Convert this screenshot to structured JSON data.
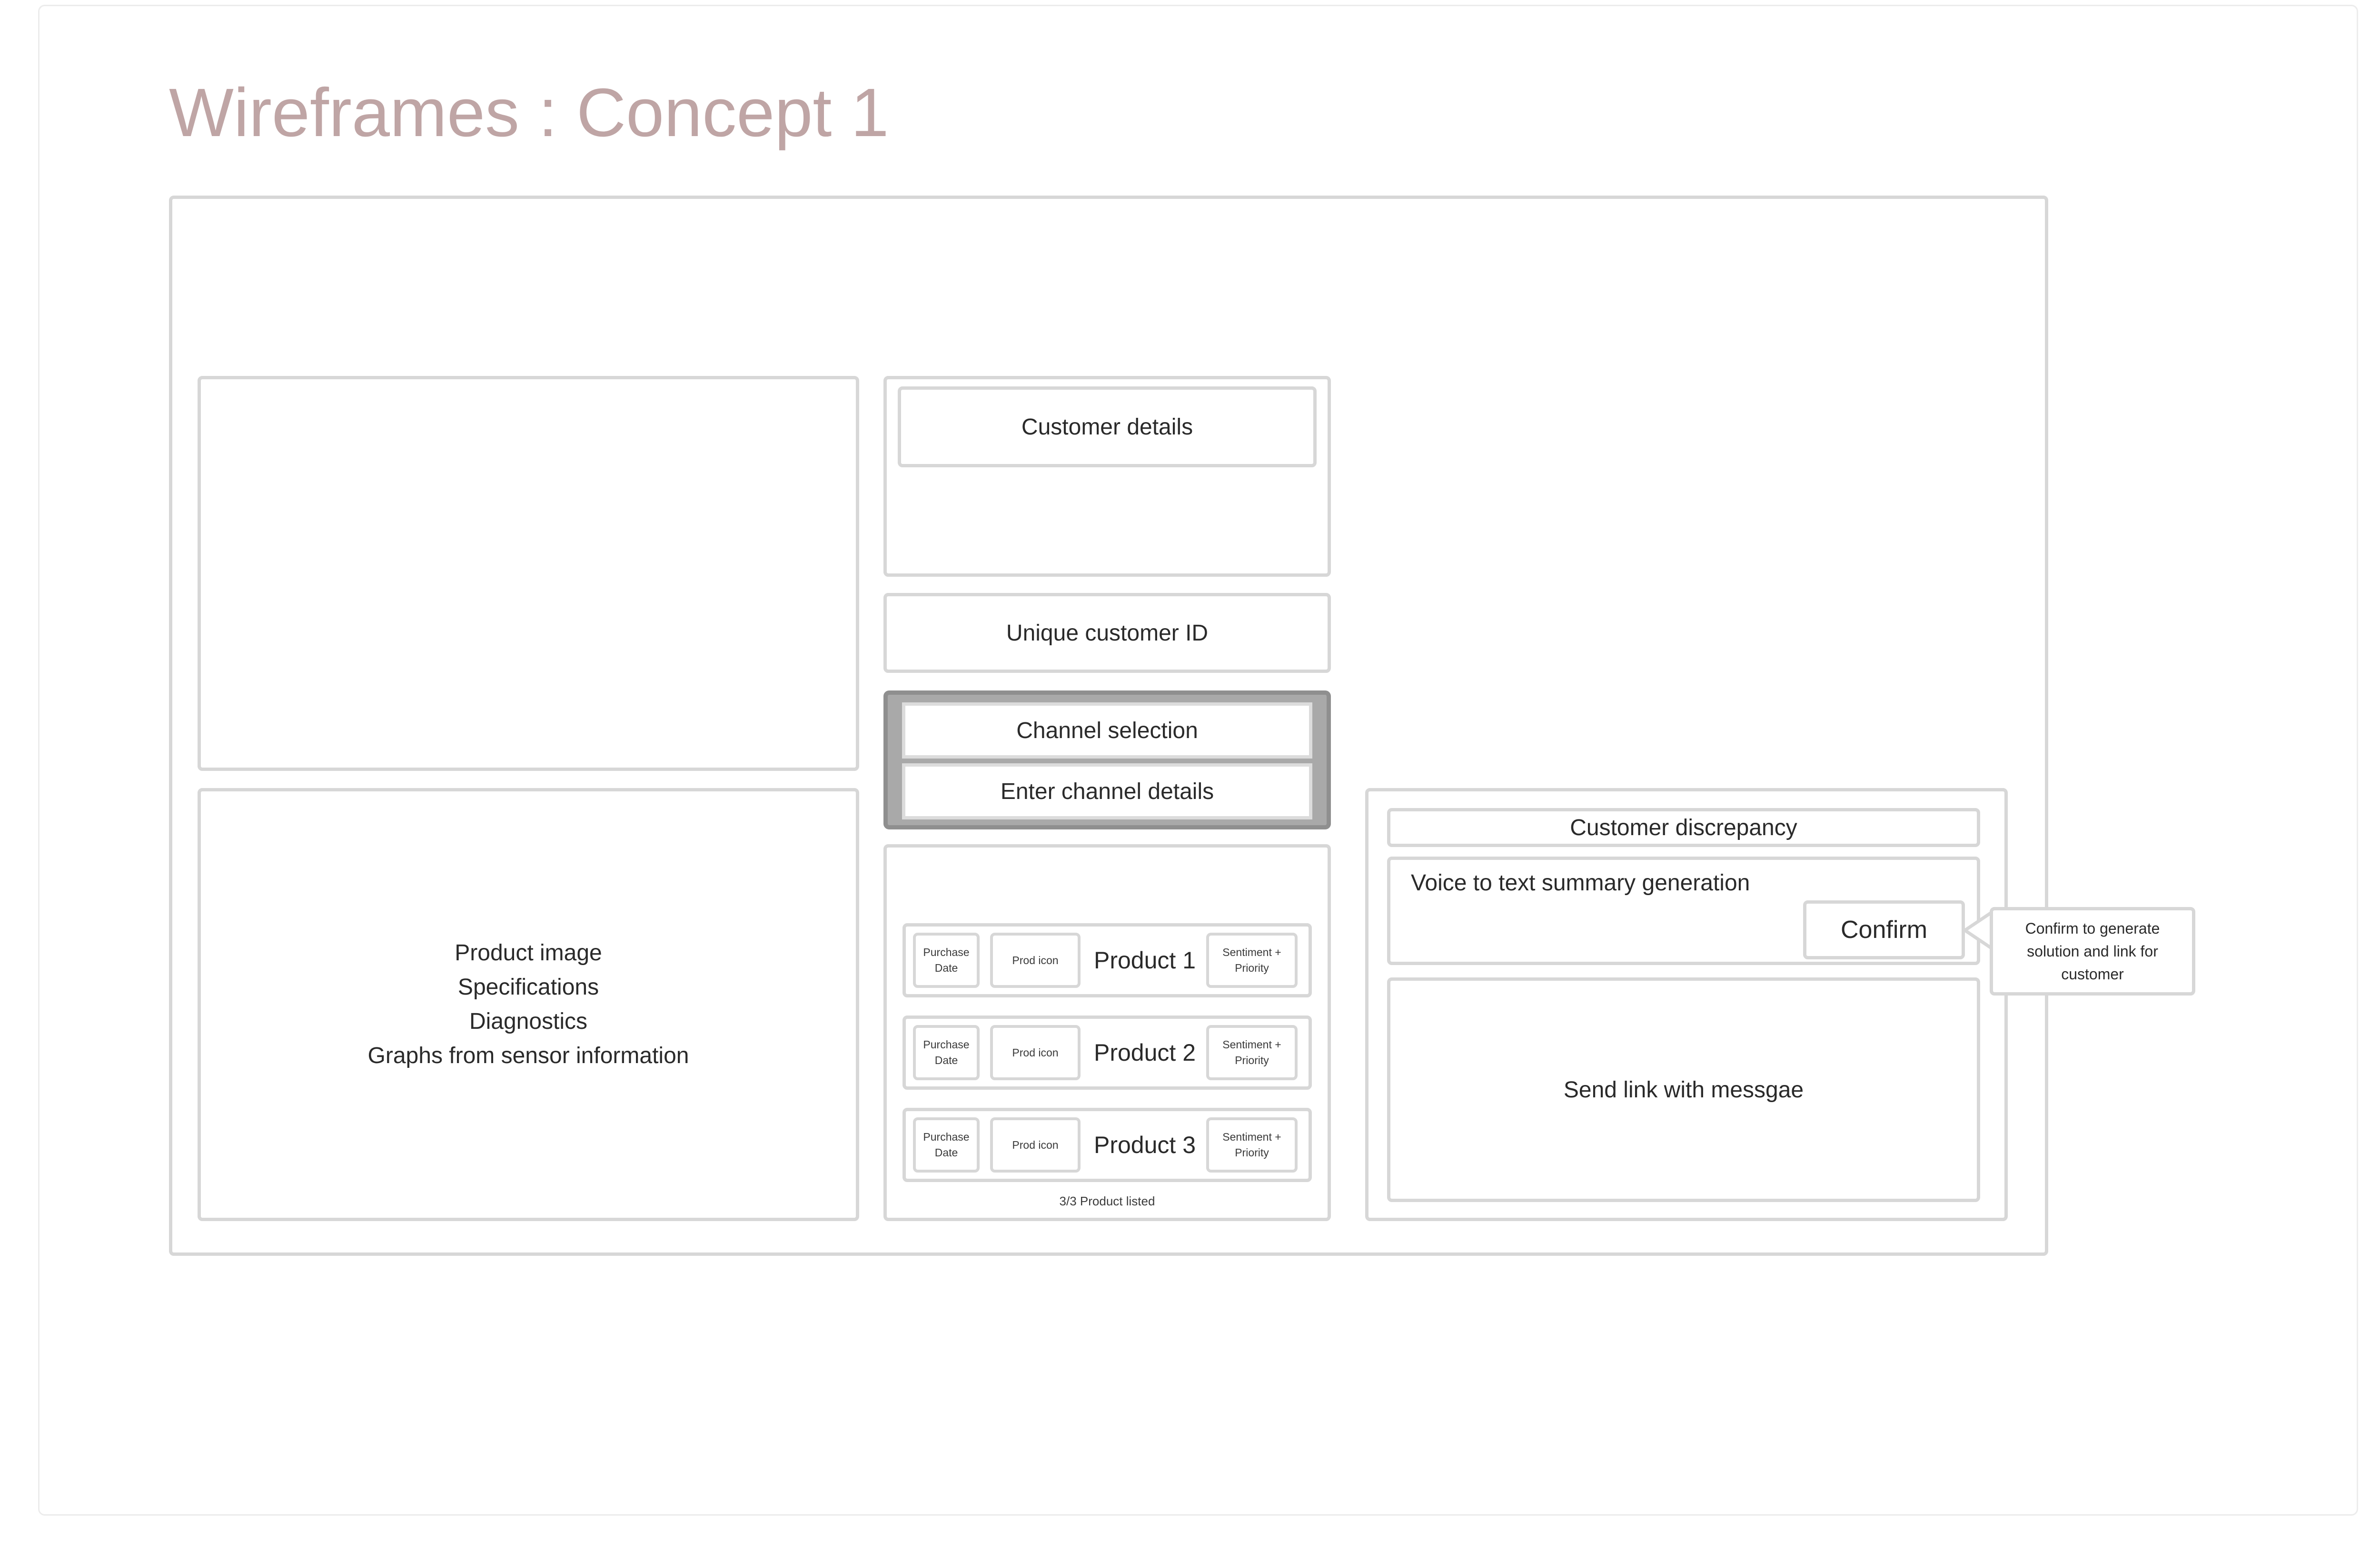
{
  "page": {
    "title": "Wireframes : Concept 1"
  },
  "product_info_panel": {
    "lines": [
      "Product image",
      "Specifications",
      "Diagnostics",
      "Graphs from sensor information"
    ]
  },
  "customer": {
    "details_label": "Customer details",
    "unique_id_label": "Unique customer ID"
  },
  "channel": {
    "selection_label": "Channel selection",
    "details_label": "Enter channel details"
  },
  "products": {
    "rows": [
      {
        "purchase_date": "Purchase Date",
        "icon_label": "Prod icon",
        "name": "Product 1",
        "sentiment": "Sentiment + Priority"
      },
      {
        "purchase_date": "Purchase Date",
        "icon_label": "Prod icon",
        "name": "Product 2",
        "sentiment": "Sentiment + Priority"
      },
      {
        "purchase_date": "Purchase Date",
        "icon_label": "Prod icon",
        "name": "Product 3",
        "sentiment": "Sentiment + Priority"
      }
    ],
    "count_label": "3/3 Product listed"
  },
  "resolution": {
    "discrepancy_label": "Customer discrepancy",
    "summary_label": "Voice to text summary generation",
    "confirm_label": "Confirm",
    "confirm_tooltip": "Confirm to generate solution and link for customer",
    "send_link_label": "Send link with messgae"
  },
  "colors": {
    "title": "#bfa5a5",
    "border": "#d7d7d7",
    "channel_group_fill": "#a9a9a9"
  }
}
